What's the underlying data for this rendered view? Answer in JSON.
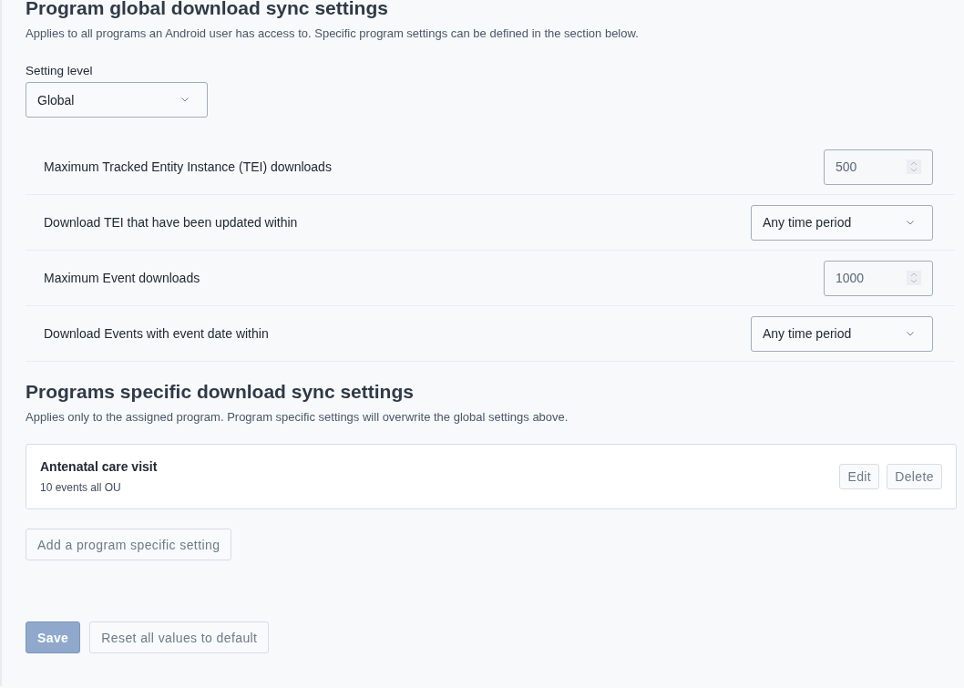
{
  "global_section": {
    "title": "Program global download sync settings",
    "description": "Applies to all programs an Android user has access to. Specific program settings can be defined in the section below."
  },
  "setting_level": {
    "label": "Setting level",
    "value": "Global"
  },
  "settings": [
    {
      "label": "Maximum Tracked Entity Instance (TEI) downloads",
      "kind": "number",
      "value": "500"
    },
    {
      "label": "Download TEI that have been updated within",
      "kind": "select",
      "value": "Any time period"
    },
    {
      "label": "Maximum Event downloads",
      "kind": "number",
      "value": "1000"
    },
    {
      "label": "Download Events with event date within",
      "kind": "select",
      "value": "Any time period"
    }
  ],
  "specific_section": {
    "title": "Programs specific download sync settings",
    "description": "Applies only to the assigned program. Program specific settings will overwrite the global settings above."
  },
  "programs": [
    {
      "name": "Antenatal care visit",
      "summary": "10 events all OU",
      "actions": [
        "Edit",
        "Delete"
      ]
    }
  ],
  "add_button": "Add a program specific setting",
  "footer_buttons": [
    {
      "label": "Save",
      "kind": "primary",
      "disabled": true
    },
    {
      "label": "Reset all values to default",
      "kind": "secondary",
      "disabled": false
    }
  ]
}
